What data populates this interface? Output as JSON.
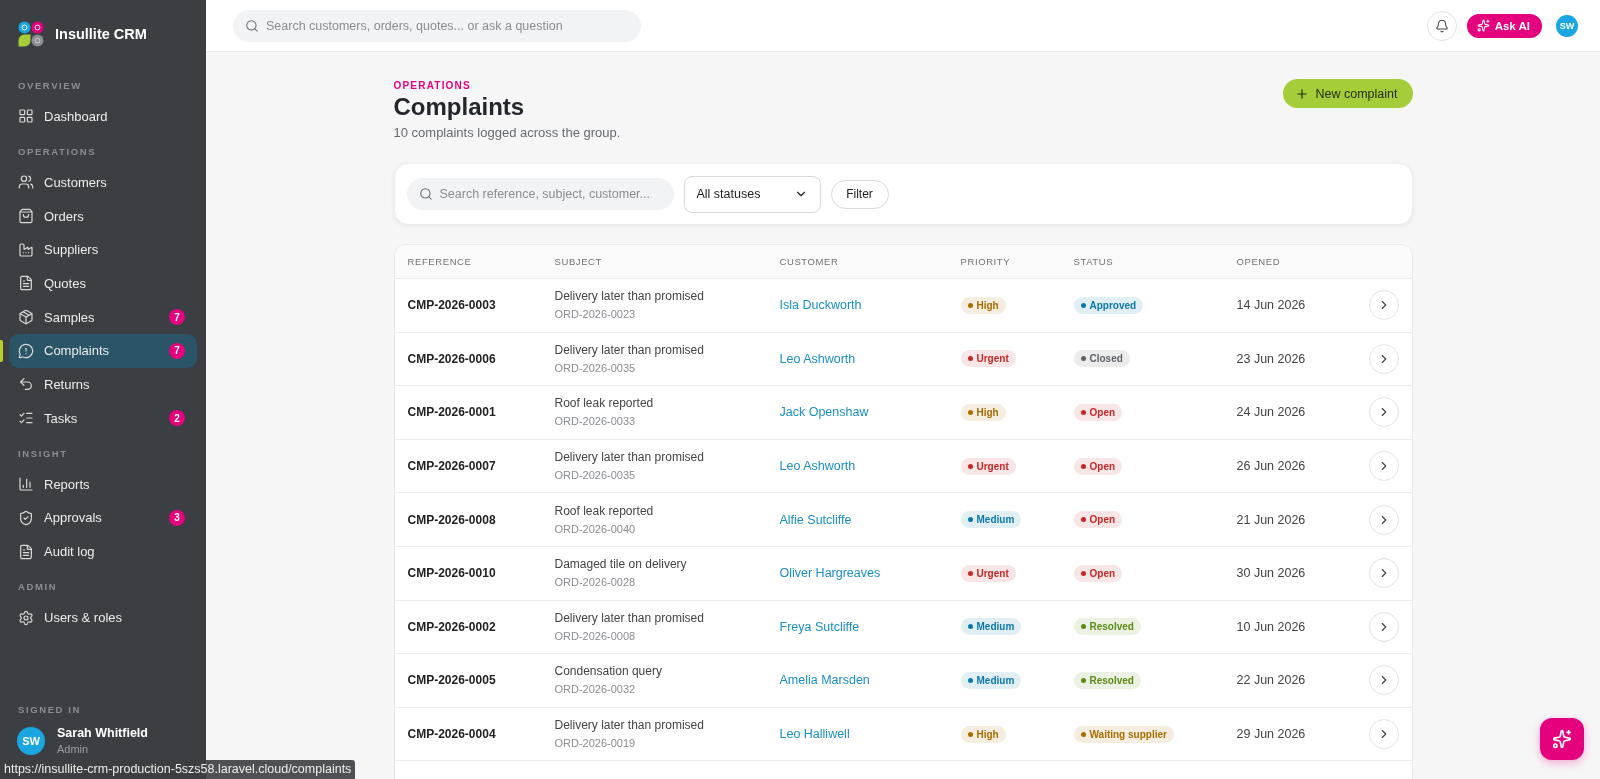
{
  "sidebar": {
    "brand": "Insullite CRM",
    "sections": [
      {
        "title": "OVERVIEW",
        "items": [
          {
            "label": "Dashboard",
            "selected": false
          }
        ]
      },
      {
        "title": "OPERATIONS",
        "items": [
          {
            "label": "Customers",
            "selected": false
          },
          {
            "label": "Orders",
            "selected": false
          },
          {
            "label": "Suppliers",
            "selected": false
          },
          {
            "label": "Quotes",
            "selected": false
          },
          {
            "label": "Samples",
            "selected": false,
            "badge": "7"
          },
          {
            "label": "Complaints",
            "selected": true,
            "badge": "7"
          },
          {
            "label": "Returns",
            "selected": false
          },
          {
            "label": "Tasks",
            "selected": false,
            "badge": "2"
          }
        ]
      },
      {
        "title": "INSIGHT",
        "items": [
          {
            "label": "Reports",
            "selected": false
          },
          {
            "label": "Approvals",
            "selected": false,
            "badge": "3"
          },
          {
            "label": "Audit log",
            "selected": false
          }
        ]
      },
      {
        "title": "ADMIN",
        "items": [
          {
            "label": "Users & roles",
            "selected": false
          }
        ]
      }
    ],
    "signed_in": {
      "label": "SIGNED IN",
      "initials": "SW",
      "name": "Sarah Whitfield",
      "role": "Admin"
    }
  },
  "top_bar": {
    "search": {
      "placeholder": "Search customers, orders, quotes... or ask a question"
    },
    "ask_ai_button": "Ask AI",
    "avatar": "SW"
  },
  "page": {
    "eyebrow": "OPERATIONS",
    "title": "Complaints",
    "subtitle": "10 complaints logged across the group.",
    "new_button": "New complaint"
  },
  "filters": {
    "search": {
      "placeholder": "Search reference, subject, customer..."
    },
    "status_select": "All statuses",
    "filter_button": "Filter"
  },
  "table": {
    "columns": [
      "REFERENCE",
      "SUBJECT",
      "CUSTOMER",
      "PRIORITY",
      "STATUS",
      "OPENED"
    ],
    "rows": [
      {
        "reference": "CMP-2026-0003",
        "subject": "Delivery later than promised",
        "order": "ORD-2026-0023",
        "customer": "Isla Duckworth",
        "priority": {
          "label": "High",
          "color": "#a86d00"
        },
        "status": {
          "label": "Approved",
          "color": "#0b78ad"
        },
        "opened": "14 Jun 2026"
      },
      {
        "reference": "CMP-2026-0006",
        "subject": "Delivery later than promised",
        "order": "ORD-2026-0035",
        "customer": "Leo Ashworth",
        "priority": {
          "label": "Urgent",
          "color": "#c62828"
        },
        "status": {
          "label": "Closed",
          "color": "#5f6368"
        },
        "opened": "23 Jun 2026"
      },
      {
        "reference": "CMP-2026-0001",
        "subject": "Roof leak reported",
        "order": "ORD-2026-0033",
        "customer": "Jack Openshaw",
        "priority": {
          "label": "High",
          "color": "#a86d00"
        },
        "status": {
          "label": "Open",
          "color": "#c62828"
        },
        "opened": "24 Jun 2026"
      },
      {
        "reference": "CMP-2026-0007",
        "subject": "Delivery later than promised",
        "order": "ORD-2026-0035",
        "customer": "Leo Ashworth",
        "priority": {
          "label": "Urgent",
          "color": "#c62828"
        },
        "status": {
          "label": "Open",
          "color": "#c62828"
        },
        "opened": "26 Jun 2026"
      },
      {
        "reference": "CMP-2026-0008",
        "subject": "Roof leak reported",
        "order": "ORD-2026-0040",
        "customer": "Alfie Sutcliffe",
        "priority": {
          "label": "Medium",
          "color": "#0b78ad"
        },
        "status": {
          "label": "Open",
          "color": "#c62828"
        },
        "opened": "21 Jun 2026"
      },
      {
        "reference": "CMP-2026-0010",
        "subject": "Damaged tile on delivery",
        "order": "ORD-2026-0028",
        "customer": "Oliver Hargreaves",
        "priority": {
          "label": "Urgent",
          "color": "#c62828"
        },
        "status": {
          "label": "Open",
          "color": "#c62828"
        },
        "opened": "30 Jun 2026"
      },
      {
        "reference": "CMP-2026-0002",
        "subject": "Delivery later than promised",
        "order": "ORD-2026-0008",
        "customer": "Freya Sutcliffe",
        "priority": {
          "label": "Medium",
          "color": "#0b78ad"
        },
        "status": {
          "label": "Resolved",
          "color": "#5c8a16"
        },
        "opened": "10 Jun 2026"
      },
      {
        "reference": "CMP-2026-0005",
        "subject": "Condensation query",
        "order": "ORD-2026-0032",
        "customer": "Amelia Marsden",
        "priority": {
          "label": "Medium",
          "color": "#0b78ad"
        },
        "status": {
          "label": "Resolved",
          "color": "#5c8a16"
        },
        "opened": "22 Jun 2026"
      },
      {
        "reference": "CMP-2026-0004",
        "subject": "Delivery later than promised",
        "order": "ORD-2026-0019",
        "customer": "Leo Halliwell",
        "priority": {
          "label": "High",
          "color": "#a86d00"
        },
        "status": {
          "label": "Waiting supplier",
          "color": "#a86d00"
        },
        "opened": "29 Jun 2026"
      }
    ]
  },
  "status_bar": {
    "url": "https://insullite-crm-production-5szs58.laravel.cloud/complaints"
  }
}
